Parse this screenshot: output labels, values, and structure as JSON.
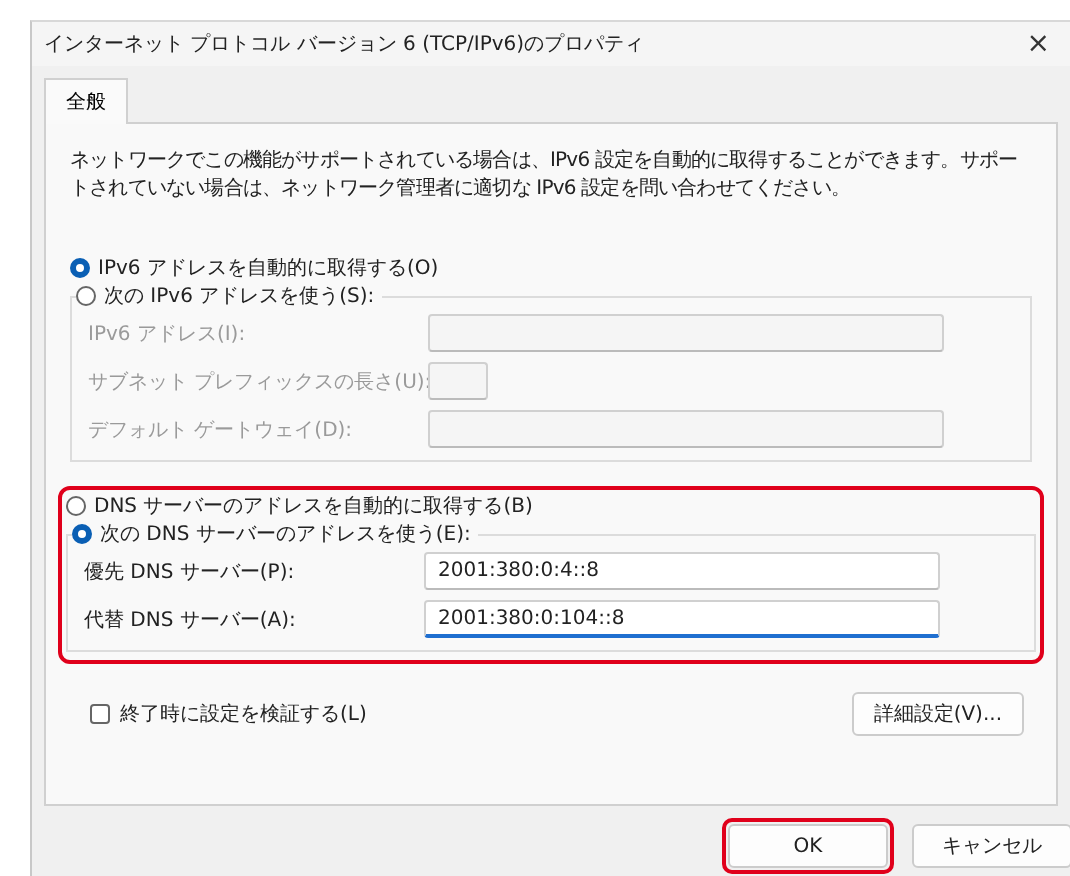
{
  "window": {
    "title": "インターネット プロトコル バージョン 6 (TCP/IPv6)のプロパティ",
    "close": "×"
  },
  "tabs": [
    {
      "label": "全般",
      "selected": true
    }
  ],
  "description": "ネットワークでこの機能がサポートされている場合は、IPv6 設定を自動的に取得することができます。サポートされていない場合は、ネットワーク管理者に適切な IPv6 設定を問い合わせてください。",
  "ipv6": {
    "options": [
      {
        "label": "IPv6 アドレスを自動的に取得する(O)",
        "selected": true
      },
      {
        "label": "次の IPv6 アドレスを使う(S):",
        "selected": false
      }
    ],
    "fields": [
      {
        "label": "IPv6 アドレス(I):",
        "kind": "wide",
        "disabled": true,
        "focused": false
      },
      {
        "label": "サブネット プレフィックスの長さ(U):",
        "kind": "short",
        "disabled": true,
        "focused": false
      },
      {
        "label": "デフォルト ゲートウェイ(D):",
        "kind": "wide",
        "disabled": true,
        "focused": false
      }
    ]
  },
  "dns": {
    "highlighted": true,
    "options": [
      {
        "label": "DNS サーバーのアドレスを自動的に取得する(B)",
        "selected": false
      },
      {
        "label": "次の DNS サーバーのアドレスを使う(E):",
        "selected": true
      }
    ],
    "fields": [
      {
        "label": "優先 DNS サーバー(P):",
        "kind": "wide",
        "disabled": false,
        "focused": false,
        "value": "2001:380:0:4::8"
      },
      {
        "label": "代替 DNS サーバー(A):",
        "kind": "wide",
        "disabled": false,
        "focused": true,
        "value": "2001:380:0:104::8"
      }
    ]
  },
  "validate": {
    "label": "終了時に設定を検証する(L)",
    "checked": false
  },
  "advanced_button": "詳細設定(V)...",
  "buttons": [
    {
      "label": "OK",
      "highlighted": true
    },
    {
      "label": "キャンセル",
      "highlighted": false
    }
  ]
}
